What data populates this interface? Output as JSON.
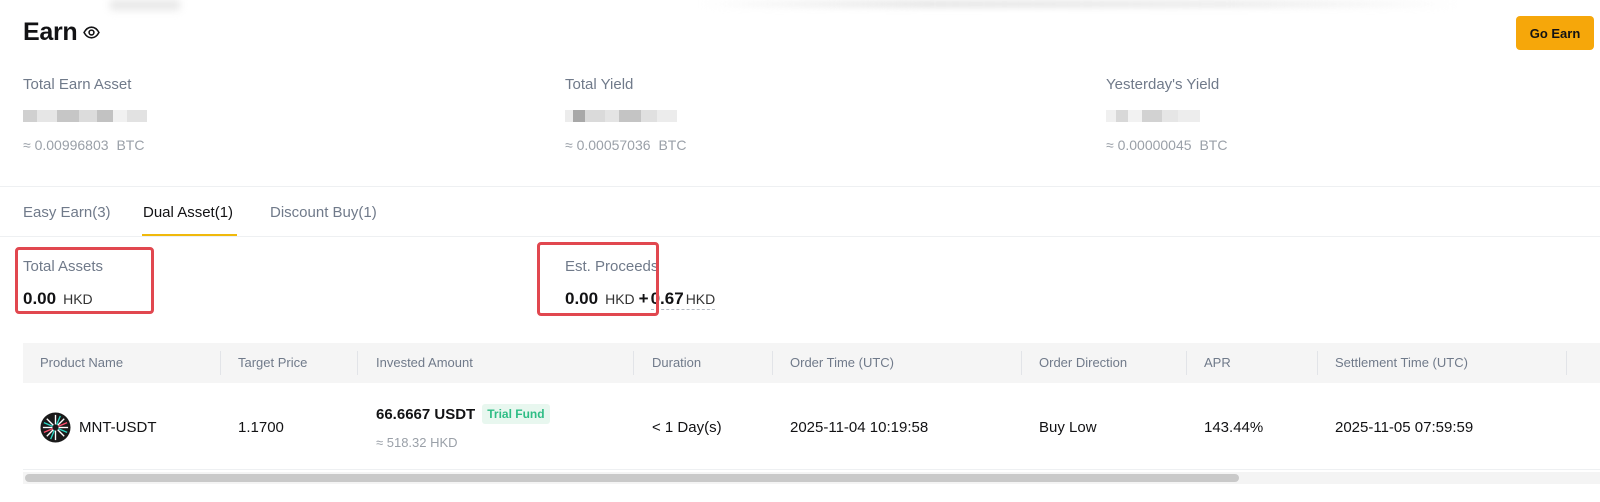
{
  "header": {
    "title": "Earn",
    "go_earn_label": "Go Earn"
  },
  "stats": [
    {
      "label": "Total Earn Asset",
      "approx": "≈ 0.00996803",
      "unit": "BTC"
    },
    {
      "label": "Total Yield",
      "approx": "≈ 0.00057036",
      "unit": "BTC"
    },
    {
      "label": "Yesterday's Yield",
      "approx": "≈ 0.00000045",
      "unit": "BTC"
    }
  ],
  "tabs": [
    {
      "label": "Easy Earn(3)"
    },
    {
      "label": "Dual Asset(1)",
      "active": true
    },
    {
      "label": "Discount Buy(1)"
    }
  ],
  "summary": {
    "total_assets_label": "Total Assets",
    "total_assets_value": "0.00",
    "total_assets_unit": "HKD",
    "proceeds_label": "Est. Proceeds",
    "proceeds_value": "0.00",
    "proceeds_unit": "HKD",
    "proceeds_plus": "+",
    "proceeds_extra": "0.67",
    "proceeds_extra_unit": "HKD"
  },
  "table": {
    "columns": [
      "Product Name",
      "Target Price",
      "Invested Amount",
      "Duration",
      "Order Time (UTC)",
      "Order Direction",
      "APR",
      "Settlement Time (UTC)"
    ],
    "rows": [
      {
        "product": "MNT-USDT",
        "target_price": "1.1700",
        "invested": "66.6667 USDT",
        "badge": "Trial Fund",
        "invested_sub": "≈ 518.32 HKD",
        "duration": "< 1 Day(s)",
        "order_time": "2025-11-04 10:19:58",
        "direction": "Buy Low",
        "apr": "143.44%",
        "settlement": "2025-11-05 07:59:59"
      }
    ]
  },
  "colors": {
    "accent": "#f6a70a",
    "highlight": "#e1474f",
    "badge_green": "#2ebd85"
  },
  "icons": {
    "visibility": "eye-icon",
    "coin": "mnt-coin-icon"
  }
}
